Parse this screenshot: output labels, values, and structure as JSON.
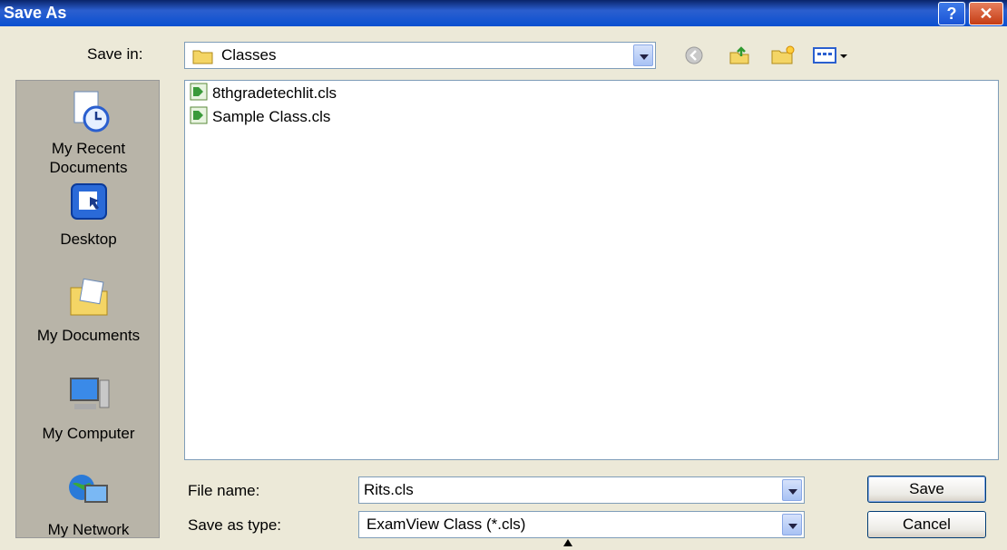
{
  "window": {
    "title": "Save As",
    "help_label": "?",
    "close_label": "✕"
  },
  "save_in": {
    "label": "Save in:",
    "value": "Classes"
  },
  "toolbar": {
    "icons": [
      "back-icon",
      "up-folder-icon",
      "new-folder-icon",
      "view-menu-icon"
    ]
  },
  "places": [
    {
      "label": "My Recent Documents",
      "icon": "recent-documents-icon"
    },
    {
      "label": "Desktop",
      "icon": "desktop-icon"
    },
    {
      "label": "My Documents",
      "icon": "my-documents-icon"
    },
    {
      "label": "My Computer",
      "icon": "my-computer-icon"
    },
    {
      "label": "My Network",
      "icon": "my-network-icon"
    }
  ],
  "files": [
    {
      "name": "8thgradetechlit.cls"
    },
    {
      "name": "Sample Class.cls"
    }
  ],
  "file_name": {
    "label": "File name:",
    "value": "Rits.cls"
  },
  "save_type": {
    "label": "Save as type:",
    "value": "ExamView Class (*.cls)"
  },
  "buttons": {
    "save": "Save",
    "cancel": "Cancel"
  },
  "colors": {
    "title_bar": "#0a50d0",
    "dialog_bg": "#ece9d8",
    "places_bg": "#b8b4a8"
  }
}
